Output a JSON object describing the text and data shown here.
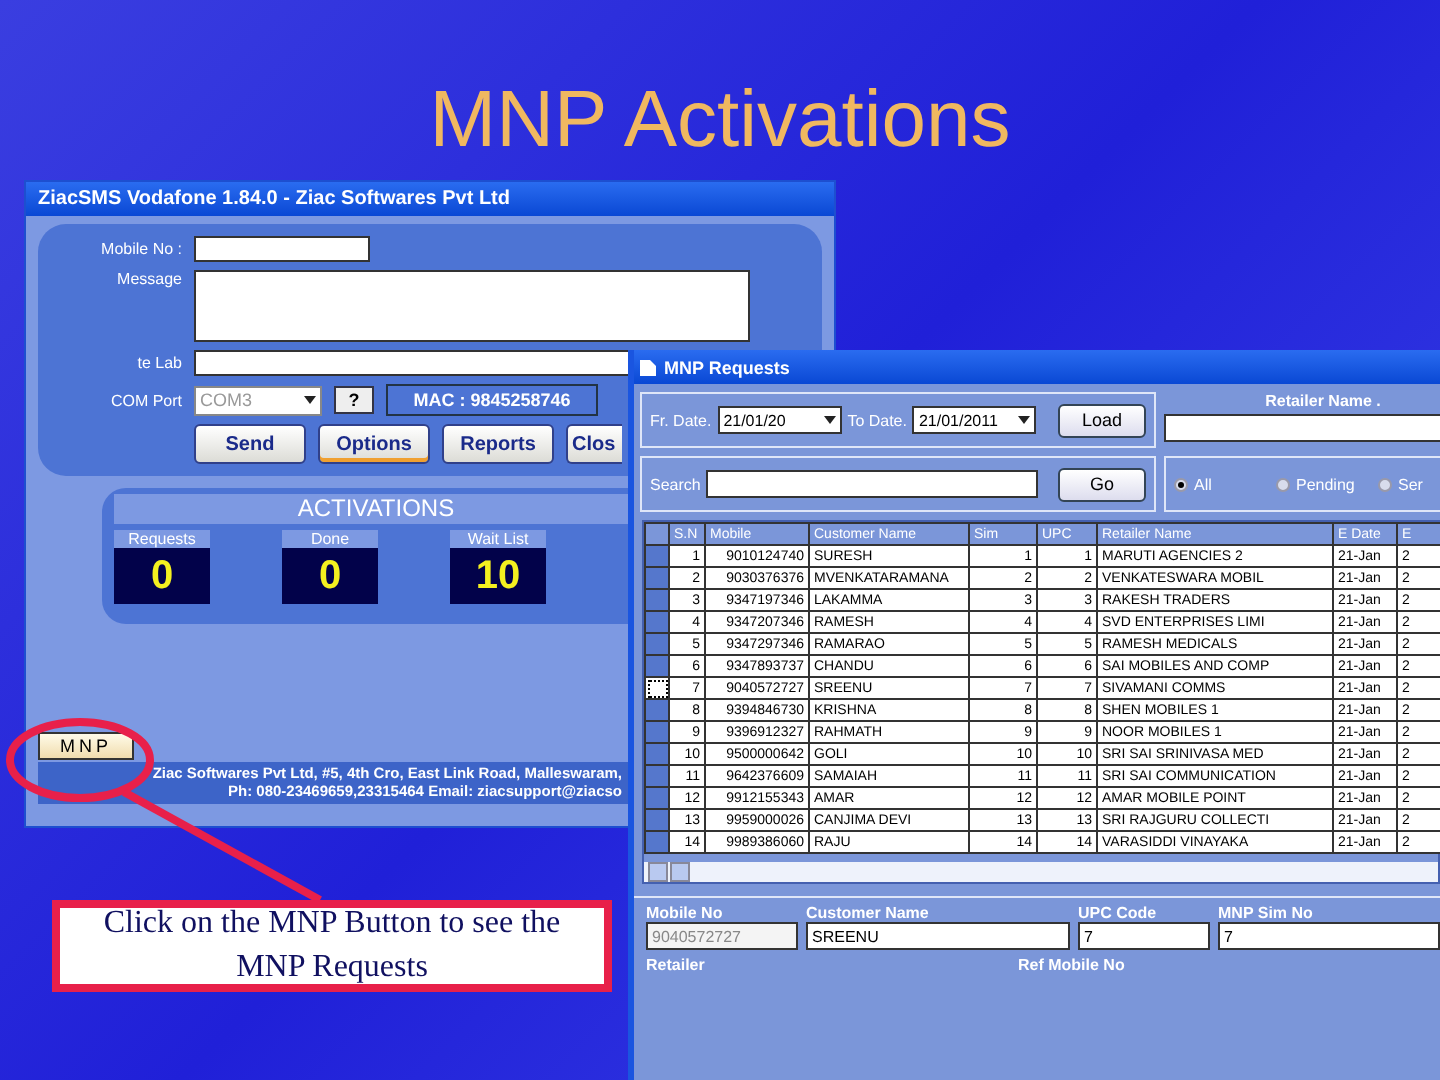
{
  "slide": {
    "title": "MNP Activations"
  },
  "main_window": {
    "title": "ZiacSMS Vodafone 1.84.0 - Ziac Softwares Pvt Ltd",
    "fields": [
      {
        "label": "Mobile No :",
        "kind": "short"
      },
      {
        "label": "Message",
        "kind": "area"
      },
      {
        "label": "te Lab",
        "kind": "long"
      }
    ],
    "com_port": {
      "label": "COM Port",
      "value": "COM3",
      "help": "?",
      "mac": "MAC : 9845258746"
    },
    "buttons": [
      {
        "label": "Send",
        "focused": false
      },
      {
        "label": "Options",
        "focused": true
      },
      {
        "label": "Reports",
        "focused": false
      },
      {
        "label": "Clos",
        "focused": false
      }
    ],
    "activations": {
      "title": "ACTIVATIONS",
      "counters": [
        {
          "label": "Requests",
          "value": "0"
        },
        {
          "label": "Done",
          "value": "0"
        },
        {
          "label": "Wait List",
          "value": "10"
        }
      ]
    },
    "mnp_button": "MNP",
    "footer": [
      "Ziac Softwares Pvt Ltd, #5, 4th Cro, East Link Road, Malleswaram,",
      "Ph: 080-23469659,23315464 Email: ziacsupport@ziacso"
    ]
  },
  "callout": {
    "text": "Click on the MNP Button to see the MNP Requests"
  },
  "requests_window": {
    "title": "MNP Requests",
    "from_label": "Fr. Date.",
    "from_value": "21/01/20",
    "to_label": "To Date.",
    "to_value": "21/01/2011",
    "load": "Load",
    "retailer_label": "Retailer Name .",
    "search_label": "Search",
    "go": "Go",
    "filters": [
      {
        "label": "All",
        "selected": true
      },
      {
        "label": "Pending",
        "selected": false
      },
      {
        "label": "Ser",
        "selected": false
      }
    ],
    "table": {
      "columns": [
        "S.N",
        "Mobile",
        "Customer Name",
        "Sim",
        "UPC",
        "Retailer Name",
        "E Date",
        "E"
      ],
      "rows": [
        {
          "focused": false,
          "cells": [
            "1",
            "9010124740",
            "SURESH",
            "1",
            "1",
            "MARUTI AGENCIES 2",
            "21-Jan",
            "2"
          ]
        },
        {
          "focused": false,
          "cells": [
            "2",
            "9030376376",
            "MVENKATARAMANA",
            "2",
            "2",
            "VENKATESWARA MOBIL",
            "21-Jan",
            "2"
          ]
        },
        {
          "focused": false,
          "cells": [
            "3",
            "9347197346",
            "LAKAMMA",
            "3",
            "3",
            "RAKESH TRADERS",
            "21-Jan",
            "2"
          ]
        },
        {
          "focused": false,
          "cells": [
            "4",
            "9347207346",
            "RAMESH",
            "4",
            "4",
            "SVD ENTERPRISES LIMI",
            "21-Jan",
            "2"
          ]
        },
        {
          "focused": false,
          "cells": [
            "5",
            "9347297346",
            "RAMARAO",
            "5",
            "5",
            "RAMESH MEDICALS",
            "21-Jan",
            "2"
          ]
        },
        {
          "focused": false,
          "cells": [
            "6",
            "9347893737",
            "CHANDU",
            "6",
            "6",
            "SAI MOBILES AND COMP",
            "21-Jan",
            "2"
          ]
        },
        {
          "focused": true,
          "cells": [
            "7",
            "9040572727",
            "SREENU",
            "7",
            "7",
            "SIVAMANI COMMS",
            "21-Jan",
            "2"
          ]
        },
        {
          "focused": false,
          "cells": [
            "8",
            "9394846730",
            "KRISHNA",
            "8",
            "8",
            "SHEN MOBILES 1",
            "21-Jan",
            "2"
          ]
        },
        {
          "focused": false,
          "cells": [
            "9",
            "9396912327",
            "RAHMATH",
            "9",
            "9",
            "NOOR MOBILES 1",
            "21-Jan",
            "2"
          ]
        },
        {
          "focused": false,
          "cells": [
            "10",
            "9500000642",
            "GOLI",
            "10",
            "10",
            "SRI SAI SRINIVASA MED",
            "21-Jan",
            "2"
          ]
        },
        {
          "focused": false,
          "cells": [
            "11",
            "9642376609",
            "SAMAIAH",
            "11",
            "11",
            "SRI SAI COMMUNICATION",
            "21-Jan",
            "2"
          ]
        },
        {
          "focused": false,
          "cells": [
            "12",
            "9912155343",
            "AMAR",
            "12",
            "12",
            "AMAR MOBILE POINT",
            "21-Jan",
            "2"
          ]
        },
        {
          "focused": false,
          "cells": [
            "13",
            "9959000026",
            "CANJIMA DEVI",
            "13",
            "13",
            "SRI RAJGURU COLLECTI",
            "21-Jan",
            "2"
          ]
        },
        {
          "focused": false,
          "cells": [
            "14",
            "9989386060",
            "RAJU",
            "14",
            "14",
            "VARASIDDI VINAYAKA",
            "21-Jan",
            "2"
          ]
        }
      ]
    },
    "details": {
      "fields": [
        {
          "label": "Mobile No",
          "value": "9040572727",
          "disabled": true
        },
        {
          "label": "Customer Name",
          "value": "SREENU",
          "disabled": false
        },
        {
          "label": "UPC Code",
          "value": "7",
          "disabled": false
        },
        {
          "label": "MNP Sim No",
          "value": "7",
          "disabled": false
        }
      ],
      "labels": [
        "Retailer",
        "Ref Mobile No"
      ]
    }
  }
}
